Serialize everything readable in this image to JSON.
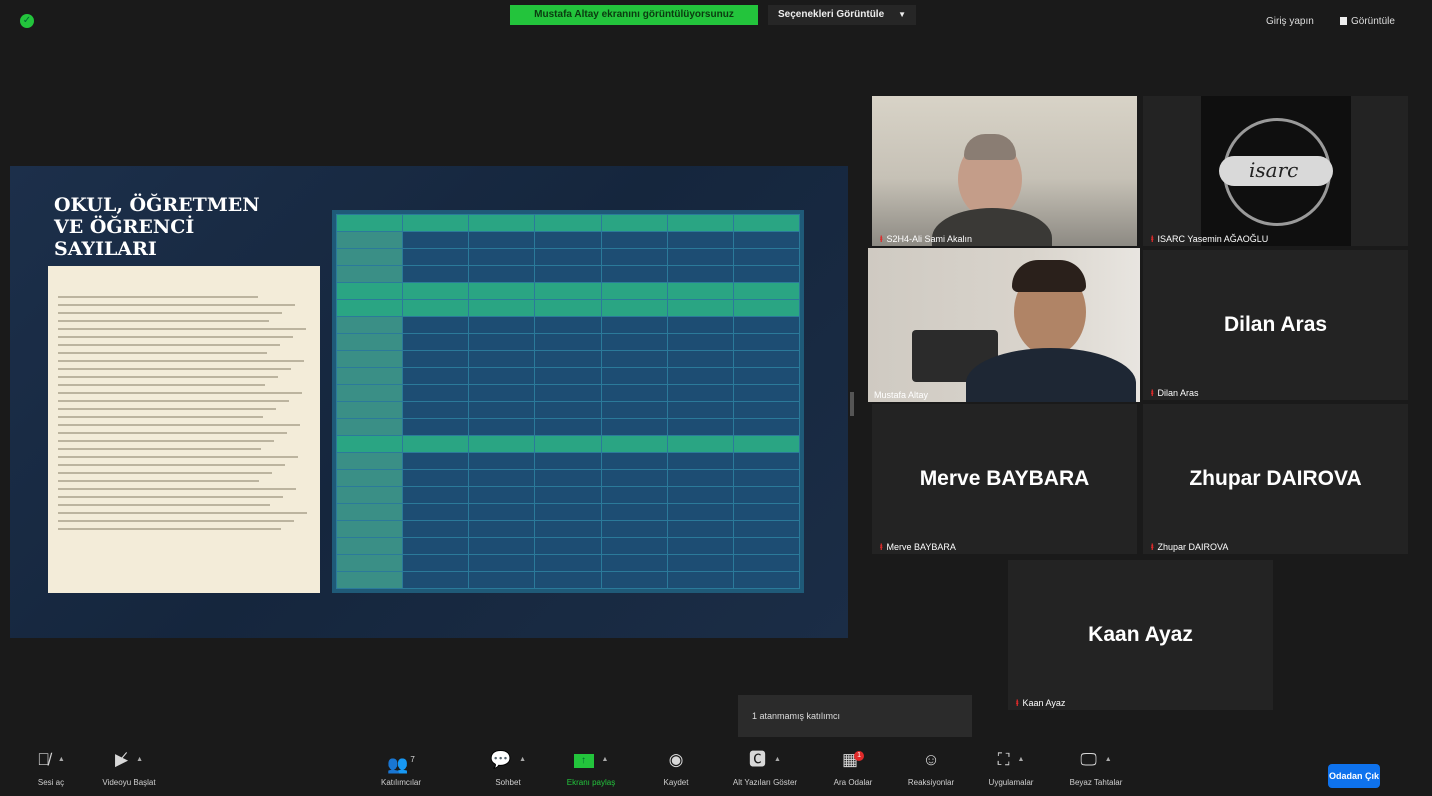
{
  "topbar": {
    "share_banner": "Mustafa Altay ekranını görüntülüyorsunuz",
    "view_options": "Seçenekleri Görüntüle",
    "signin": "Giriş yapın",
    "view": "Görüntüle"
  },
  "slide": {
    "title_lines": [
      "OKUL, ÖĞRETMEN",
      "VE ÖĞRENCİ",
      "SAYILARI"
    ]
  },
  "gallery": {
    "tiles": [
      {
        "label": "S2H4-Ali Sami Akalın"
      },
      {
        "label": "ISARC Yasemin AĞAOĞLU",
        "logo_text": "isarc"
      },
      {
        "label": "Mustafa Altay"
      },
      {
        "name": "Dilan Aras",
        "label": "Dilan Aras"
      },
      {
        "name": "Merve BAYBARA",
        "label": "Merve BAYBARA"
      },
      {
        "name": "Zhupar DAIROVA",
        "label": "Zhupar DAIROVA"
      },
      {
        "name": "Kaan Ayaz",
        "label": "Kaan Ayaz"
      }
    ]
  },
  "unassigned": "1 atanmamış katılımcı",
  "toolbar": {
    "items": [
      {
        "label": "Sesi aç",
        "icon": "muted-mic-icon"
      },
      {
        "label": "Videoyu Başlat",
        "icon": "video-off-icon"
      },
      {
        "label": "Katılımcılar",
        "icon": "participants-icon",
        "count": "7"
      },
      {
        "label": "Sohbet",
        "icon": "chat-icon"
      },
      {
        "label": "Ekranı paylaş",
        "icon": "share-screen-icon"
      },
      {
        "label": "Kaydet",
        "icon": "record-icon"
      },
      {
        "label": "Alt Yazıları Göster",
        "icon": "cc-icon"
      },
      {
        "label": "Ara Odalar",
        "icon": "breakout-rooms-icon",
        "badge": "1"
      },
      {
        "label": "Reaksiyonlar",
        "icon": "reactions-icon"
      },
      {
        "label": "Uygulamalar",
        "icon": "apps-icon"
      },
      {
        "label": "Beyaz Tahtalar",
        "icon": "whiteboard-icon"
      }
    ],
    "leave": "Odadan Çık"
  },
  "colors": {
    "share_green": "#23c43c",
    "leave_blue": "#0e72ed",
    "active_speaker": "#d9e047",
    "muted_red": "#e02a2a"
  }
}
